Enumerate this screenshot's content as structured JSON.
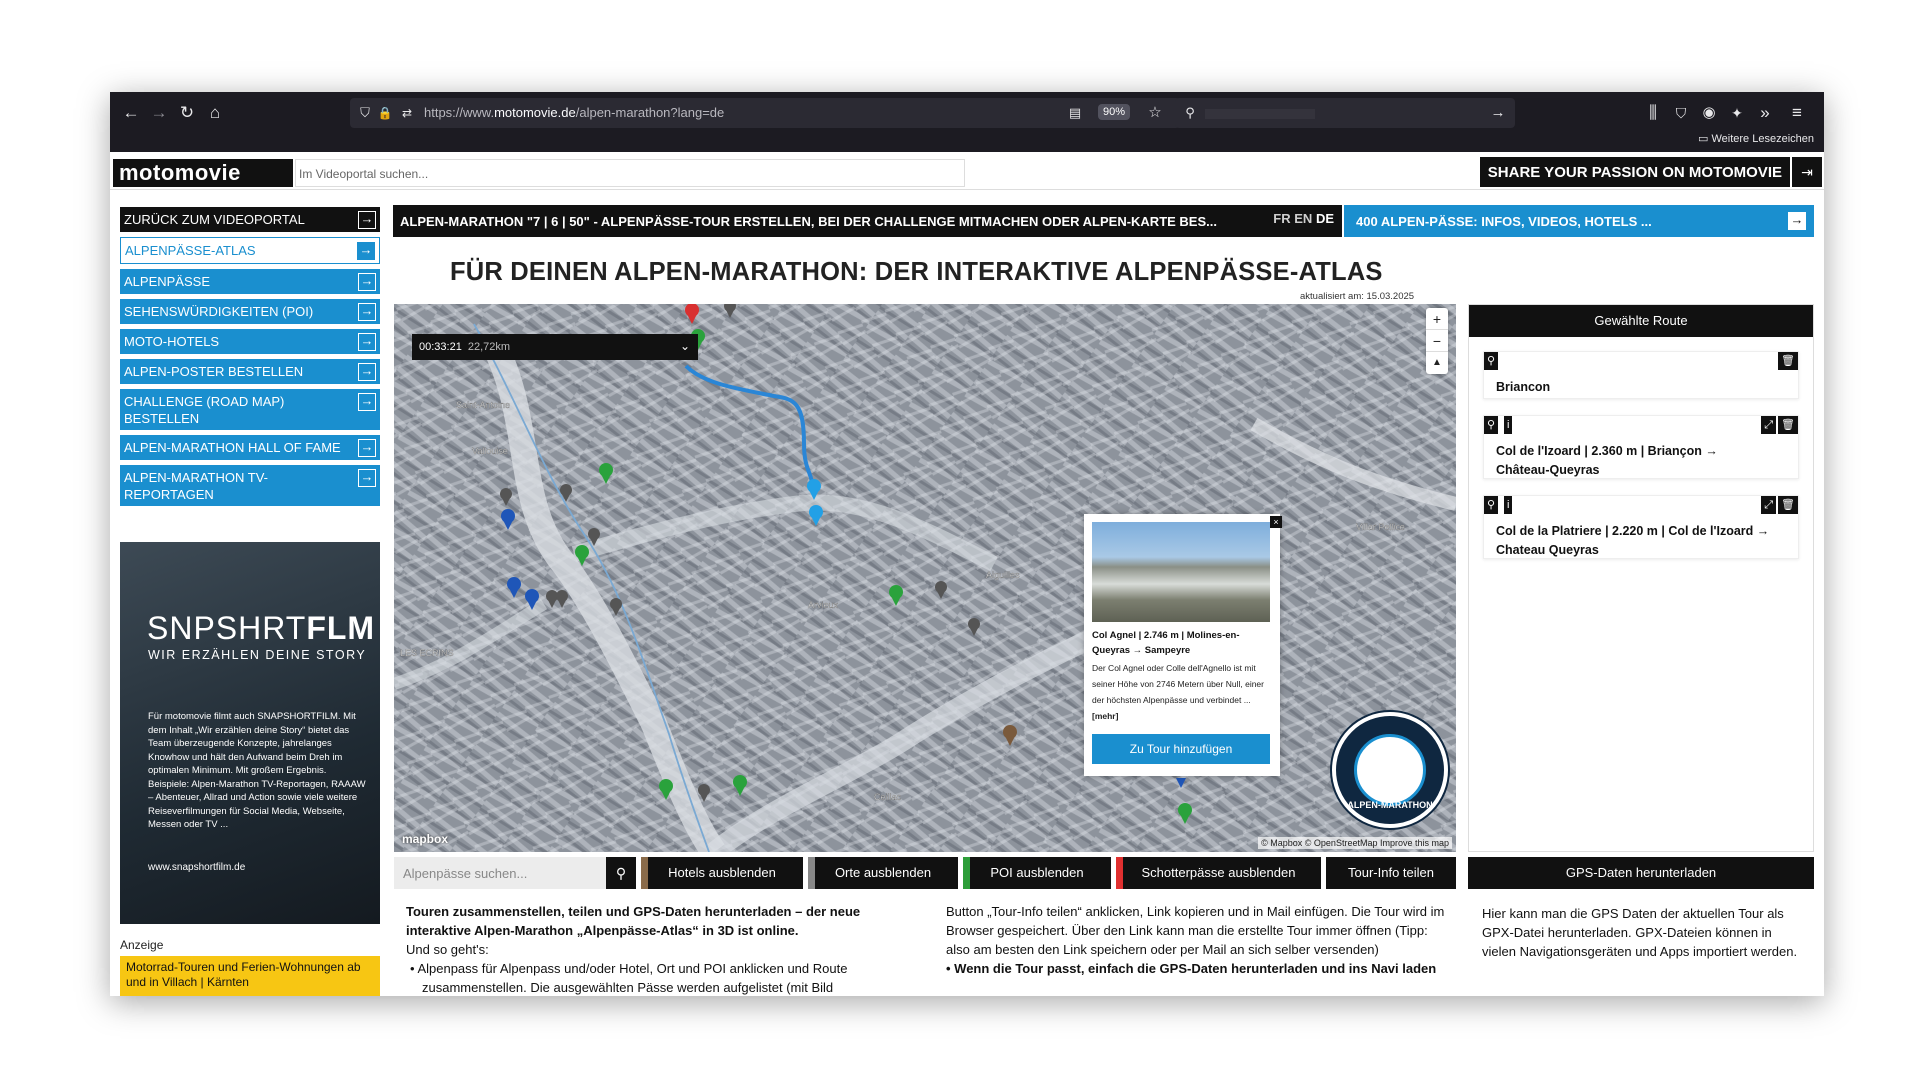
{
  "browser": {
    "url_prefix": "https://www.",
    "url_domain": "motomovie.de",
    "url_path": "/alpen-marathon?lang=de",
    "zoom": "90%",
    "bookmarks_label": "Weitere Lesezeichen"
  },
  "header": {
    "logo": "motomovie",
    "search_placeholder": "Im Videoportal suchen...",
    "share_label": "SHARE YOUR PASSION ON MOTOMOVIE"
  },
  "sidebar": {
    "items": [
      {
        "label": "ZURÜCK ZUM VIDEOPORTAL"
      },
      {
        "label": "ALPENPÄSSE-ATLAS"
      },
      {
        "label": "ALPENPÄSSE"
      },
      {
        "label": "SEHENSWÜRDIGKEITEN (POI)"
      },
      {
        "label": "MOTO-HOTELS"
      },
      {
        "label": "ALPEN-POSTER BESTELLEN"
      },
      {
        "label": "CHALLENGE (ROAD MAP) BESTELLEN"
      },
      {
        "label": "ALPEN-MARATHON HALL OF FAME"
      },
      {
        "label": "ALPEN-MARATHON TV-REPORTAGEN"
      }
    ]
  },
  "ad": {
    "brand_light": "SNPSHRT",
    "brand_bold": "FLM",
    "tagline": "WIR ERZÄHLEN DEINE STORY",
    "text": "Für motomovie filmt auch SNAPSHORTFILM. Mit dem Inhalt „Wir erzählen deine Story“ bietet das Team überzeugende Konzepte, jahrelanges Knowhow und hält den Aufwand beim Dreh im optimalen Minimum. Mit großem Ergebnis. Beispiele: Alpen-Marathon TV-Reportagen, RAAAW – Abenteuer, Allrad und Action sowie viele weitere Reiseverfilmungen für Social Media, Webseite, Messen oder TV ...",
    "url": "www.snapshortfilm.de",
    "label": "Anzeige",
    "ad2": "Motorrad-Touren und Ferien-Wohnungen ab und in Villach | Kärnten"
  },
  "main": {
    "topbar": "ALPEN-MARATHON \"7 | 6 | 50\" - ALPENPÄSSE-TOUR ERSTELLEN, BEI DER CHALLENGE MITMACHEN ODER ALPEN-KARTE BES...",
    "flags": [
      "FR",
      "EN",
      "DE"
    ],
    "topbar2": "400 ALPEN-PÄSSE: INFOS, VIDEOS, HOTELS ...",
    "title": "FÜR DEINEN ALPEN-MARATHON: DER INTERAKTIVE ALPENPÄSSE-ATLAS",
    "updated": "aktualisiert am: 15.03.2025"
  },
  "map": {
    "time": "00:33:21",
    "distance": "22,72km",
    "place_labels": [
      "Saint-Antoine",
      "Vallouise",
      "Villar Pellice",
      "Aiguilles",
      "Arvieux",
      "LES ECRINS",
      "Ceillac"
    ],
    "mapbox": "mapbox",
    "attribution": "© Mapbox © OpenStreetMap Improve this map",
    "badge_label": "ALPEN-MARATHON"
  },
  "popup": {
    "title": "Col Agnel | 2.746 m | Molines-en-Queyras → Sampeyre",
    "description": "Der Col Agnel oder Colle dell'Agnello ist mit seiner Höhe von 2746 Metern über Null, einer der höchsten Alpenpässe und verbindet ...",
    "more": "[mehr]",
    "button": "Zu Tour hinzufügen"
  },
  "toolbar": {
    "search_placeholder": "Alpenpässe suchen...",
    "buttons": [
      {
        "label": "Hotels ausblenden",
        "color": "#8a6b4a"
      },
      {
        "label": "Orte ausblenden",
        "color": "#888888"
      },
      {
        "label": "POI ausblenden",
        "color": "#2e9e3a"
      },
      {
        "label": "Schotterpässe ausblenden",
        "color": "#e03030"
      },
      {
        "label": "Tour-Info teilen",
        "color": ""
      }
    ]
  },
  "route": {
    "title": "Gewählte Route",
    "items": [
      {
        "name": "Briancon"
      },
      {
        "name": "Col de l'Izoard | 2.360 m | Briançon → Château-Queyras"
      },
      {
        "name": "Col de la Platriere | 2.220 m | Col de l'Izoard → Chateau Queyras"
      }
    ],
    "gps_button": "GPS-Daten herunterladen",
    "gps_text": "Hier kann man die GPS Daten der aktuellen Tour als GPX-Datei herunterladen. GPX-Dateien können in vielen Navigationsgeräten und Apps importiert werden."
  },
  "article": {
    "intro_bold": "Touren zusammenstellen, teilen und GPS-Daten herunterladen – der neue interaktive Alpen-Marathon „Alpenpässe-Atlas“ in 3D ist online.",
    "howto": "Und so geht's:",
    "bullet1": "Alpenpass für Alpenpass und/oder Hotel, Ort und POI anklicken und Route zusammenstellen. Die ausgewählten Pässe werden aufgelistet (mit Bild",
    "right_text": "Button „Tour-Info teilen“ anklicken, Link kopieren und in Mail einfügen. Die Tour wird im Browser gespeichert. Über den Link kann man die erstellte Tour immer öffnen (Tipp: also am besten den Link speichern oder per Mail an sich selber versenden)",
    "right_bullet": "Wenn die Tour passt, einfach die GPS-Daten herunterladen und ins Navi laden"
  }
}
